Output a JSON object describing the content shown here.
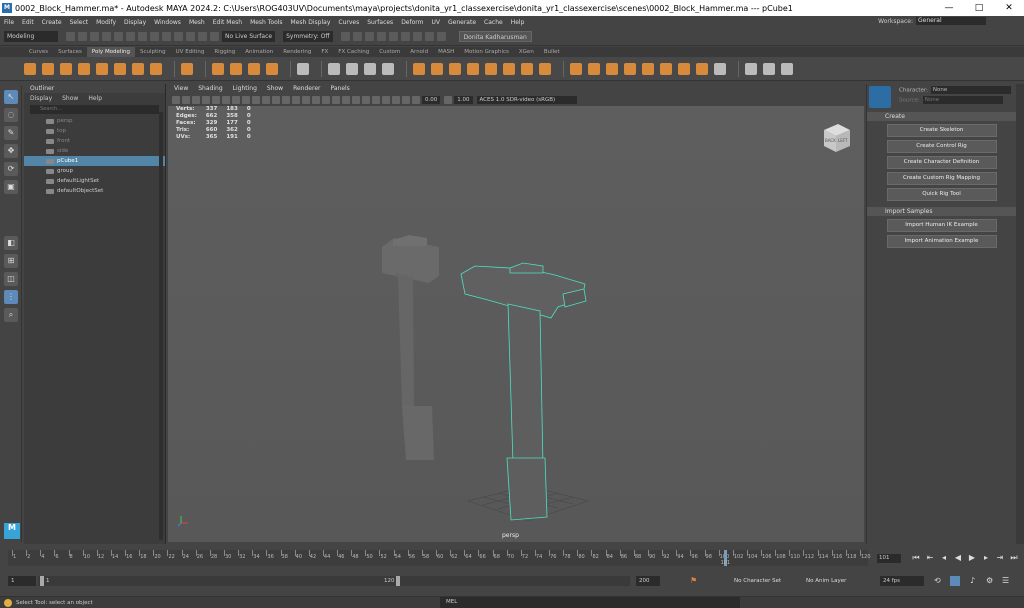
{
  "window": {
    "title": "0002_Block_Hammer.ma* - Autodesk MAYA 2024.2: C:\\Users\\ROG403UV\\Documents\\maya\\projects\\donita_yr1_classexercise\\donita_yr1_classexercise\\scenes\\0002_Block_Hammer.ma  ---  pCube1",
    "minimize": "—",
    "maximize": "□",
    "close": "✕"
  },
  "menu": [
    "File",
    "Edit",
    "Create",
    "Select",
    "Modify",
    "Display",
    "Windows",
    "Mesh",
    "Edit Mesh",
    "Mesh Tools",
    "Mesh Display",
    "Curves",
    "Surfaces",
    "Deform",
    "UV",
    "Generate",
    "Cache",
    "Help"
  ],
  "workspace": {
    "label": "Workspace:",
    "value": "General"
  },
  "statusline": {
    "mode": "Modeling",
    "live_surface": "No Live Surface",
    "symmetry": "Symmetry: Off",
    "user": "Donita Kadharusman"
  },
  "shelf_tabs": [
    "Curves",
    "Surfaces",
    "Poly Modeling",
    "Sculpting",
    "UV Editing",
    "Rigging",
    "Animation",
    "Rendering",
    "FX",
    "FX Caching",
    "Custom",
    "Arnold",
    "MASH",
    "Motion Graphics",
    "XGen",
    "Bullet"
  ],
  "shelf_active_tab": "Poly Modeling",
  "outliner": {
    "title": "Outliner",
    "menu": [
      "Display",
      "Show",
      "Help"
    ],
    "search_placeholder": "Search...",
    "items": [
      {
        "label": "persp",
        "dim": true
      },
      {
        "label": "top",
        "dim": true
      },
      {
        "label": "front",
        "dim": true
      },
      {
        "label": "side",
        "dim": true
      },
      {
        "label": "pCube1",
        "selected": true
      },
      {
        "label": "group"
      },
      {
        "label": "defaultLightSet"
      },
      {
        "label": "defaultObjectSet"
      }
    ]
  },
  "viewport": {
    "menu": [
      "View",
      "Shading",
      "Lighting",
      "Show",
      "Renderer",
      "Panels"
    ],
    "field1": "0.00",
    "field2": "1.00",
    "colorspace": "ACES 1.0 SDR-video (sRGB)",
    "camera": "persp",
    "hud": [
      {
        "label": "Verts:",
        "a": "337",
        "b": "183",
        "c": "0"
      },
      {
        "label": "Edges:",
        "a": "662",
        "b": "358",
        "c": "0"
      },
      {
        "label": "Faces:",
        "a": "329",
        "b": "177",
        "c": "0"
      },
      {
        "label": "Tris:",
        "a": "660",
        "b": "362",
        "c": "0"
      },
      {
        "label": "UVs:",
        "a": "365",
        "b": "191",
        "c": "0"
      }
    ],
    "viewcube_back": "BACK",
    "viewcube_left": "LEFT"
  },
  "hik": {
    "character_label": "Character:",
    "character_value": "None",
    "source_label": "Source:",
    "source_value": "None",
    "section_create": "Create",
    "create_buttons": [
      "Create Skeleton",
      "Create Control Rig",
      "Create Character Definition",
      "Create Custom Rig Mapping",
      "Quick Rig Tool"
    ],
    "section_import": "Import Samples",
    "import_buttons": [
      "Import Human IK Example",
      "Import Animation Example"
    ]
  },
  "timeline": {
    "ticks": [
      "1",
      "2",
      "4",
      "6",
      "8",
      "10",
      "12",
      "14",
      "16",
      "18",
      "20",
      "22",
      "24",
      "26",
      "28",
      "30",
      "32",
      "34",
      "36",
      "38",
      "40",
      "42",
      "44",
      "46",
      "48",
      "50",
      "52",
      "54",
      "56",
      "58",
      "60",
      "62",
      "64",
      "66",
      "68",
      "70",
      "72",
      "74",
      "76",
      "78",
      "80",
      "82",
      "84",
      "86",
      "88",
      "90",
      "92",
      "94",
      "96",
      "98",
      "100",
      "102",
      "104",
      "106",
      "108",
      "110",
      "112",
      "114",
      "116",
      "118",
      "120"
    ],
    "current_frame_label": "101",
    "current_frame": "101"
  },
  "range": {
    "start": "1",
    "inner_start": "1",
    "inner_end": "120",
    "end": "200",
    "char_set": "No Character Set",
    "anim_layer": "No Anim Layer",
    "fps": "24 fps"
  },
  "help": {
    "text": "Select Tool: select an object",
    "mel": "MEL"
  }
}
